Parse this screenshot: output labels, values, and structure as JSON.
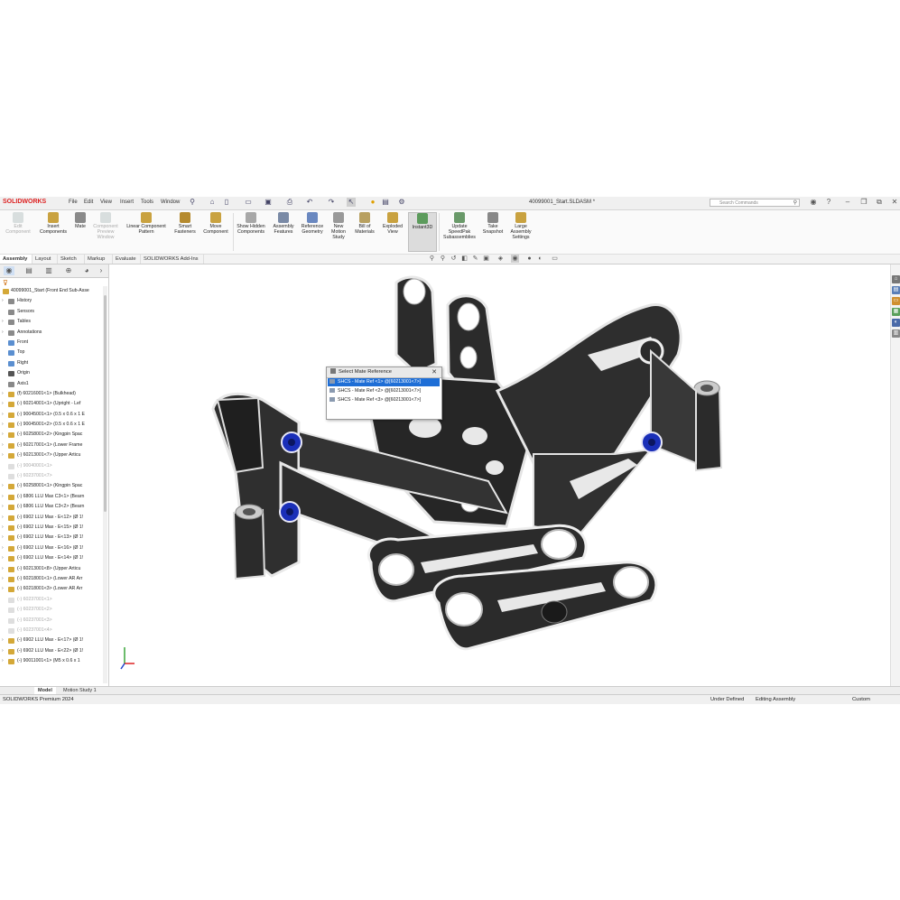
{
  "app": {
    "logo": "SOLIDWORKS",
    "menus": [
      "File",
      "Edit",
      "View",
      "Insert",
      "Tools",
      "Window"
    ],
    "document_title": "40099001_Start.SLDASM *",
    "search_placeholder": "Search Commands"
  },
  "commands": [
    {
      "label": "Edit Component",
      "enabled": false
    },
    {
      "label": "Insert Components",
      "enabled": true
    },
    {
      "label": "Mate",
      "enabled": true
    },
    {
      "label": "Component Preview Window",
      "enabled": false
    },
    {
      "label": "Linear Component Pattern",
      "enabled": true
    },
    {
      "label": "Smart Fasteners",
      "enabled": true
    },
    {
      "label": "Move Component",
      "enabled": true
    },
    {
      "label": "Show Hidden Components",
      "enabled": true
    },
    {
      "label": "Assembly Features",
      "enabled": true
    },
    {
      "label": "Reference Geometry",
      "enabled": true
    },
    {
      "label": "New Motion Study",
      "enabled": true
    },
    {
      "label": "Bill of Materials",
      "enabled": true
    },
    {
      "label": "Exploded View",
      "enabled": true
    },
    {
      "label": "Instant3D",
      "enabled": true,
      "active": true
    },
    {
      "label": "Update SpeedPak Subassemblies",
      "enabled": true
    },
    {
      "label": "Take Snapshot",
      "enabled": true
    },
    {
      "label": "Large Assembly Settings",
      "enabled": true
    }
  ],
  "tabs": [
    "Assembly",
    "Layout",
    "Sketch",
    "Markup",
    "Evaluate",
    "SOLIDWORKS Add-Ins"
  ],
  "tree": {
    "root": "40099001_Start (Front End Sub-Asse",
    "items": [
      {
        "label": "History",
        "icon": "history-icon",
        "expand": true,
        "suppressed": false
      },
      {
        "label": "Sensors",
        "icon": "sensor-icon",
        "expand": false,
        "suppressed": false
      },
      {
        "label": "Tables",
        "icon": "table-icon",
        "expand": true,
        "suppressed": false
      },
      {
        "label": "Annotations",
        "icon": "annotation-icon",
        "expand": true,
        "suppressed": false
      },
      {
        "label": "Front",
        "icon": "plane-icon",
        "expand": false,
        "suppressed": false
      },
      {
        "label": "Top",
        "icon": "plane-icon",
        "expand": false,
        "suppressed": false
      },
      {
        "label": "Right",
        "icon": "plane-icon",
        "expand": false,
        "suppressed": false
      },
      {
        "label": "Origin",
        "icon": "origin-icon",
        "expand": false,
        "suppressed": false
      },
      {
        "label": "Axis1",
        "icon": "axis-icon",
        "expand": false,
        "suppressed": false
      },
      {
        "label": "(f) 60216001<1> (Bulkhead)",
        "icon": "part-icon",
        "expand": true,
        "suppressed": false
      },
      {
        "label": "(-) 60214001<1> (Upright - Lef",
        "icon": "part-icon",
        "expand": true,
        "suppressed": false
      },
      {
        "label": "(-) 90045001<1> (0.5 x 0.6 x 1 E",
        "icon": "part-icon",
        "expand": true,
        "suppressed": false
      },
      {
        "label": "(-) 90045001<2> (0.5 x 0.6 x 1 E",
        "icon": "part-icon",
        "expand": true,
        "suppressed": false
      },
      {
        "label": "(-) 60258001<2> (Kingpin Spac",
        "icon": "part-icon",
        "expand": true,
        "suppressed": false
      },
      {
        "label": "(-) 60217001<1> (Lower Frame",
        "icon": "part-icon",
        "expand": true,
        "suppressed": false
      },
      {
        "label": "(-) 60213001<7> (Upper Articu",
        "icon": "part-icon",
        "expand": true,
        "suppressed": false
      },
      {
        "label": "(-) 90040001<1>",
        "icon": "part-icon",
        "expand": false,
        "suppressed": true
      },
      {
        "label": "(-) 60237001<7>",
        "icon": "part-icon",
        "expand": false,
        "suppressed": true
      },
      {
        "label": "(-) 60258001<1> (Kingpin Spac",
        "icon": "part-icon",
        "expand": true,
        "suppressed": false
      },
      {
        "label": "(-) 6806 LLU Max C3<1> (Bearn",
        "icon": "part-icon",
        "expand": true,
        "suppressed": false
      },
      {
        "label": "(-) 6806 LLU Max C3<2> (Bearn",
        "icon": "part-icon",
        "expand": true,
        "suppressed": false
      },
      {
        "label": "(-) 6902 LLU Max - E<12> (Ø 1!",
        "icon": "part-icon",
        "expand": true,
        "suppressed": false
      },
      {
        "label": "(-) 6902 LLU Max - E<15> (Ø 1!",
        "icon": "part-icon",
        "expand": true,
        "suppressed": false
      },
      {
        "label": "(-) 6902 LLU Max - E<13> (Ø 1!",
        "icon": "part-icon",
        "expand": true,
        "suppressed": false
      },
      {
        "label": "(-) 6902 LLU Max - E<16> (Ø 1!",
        "icon": "part-icon",
        "expand": true,
        "suppressed": false
      },
      {
        "label": "(-) 6902 LLU Max - E<14> (Ø 1!",
        "icon": "part-icon",
        "expand": true,
        "suppressed": false
      },
      {
        "label": "(-) 60213001<8> (Upper Articu",
        "icon": "part-icon",
        "expand": true,
        "suppressed": false
      },
      {
        "label": "(-) 60218001<1> (Lower AR Arr",
        "icon": "part-icon",
        "expand": true,
        "suppressed": false
      },
      {
        "label": "(-) 60218001<3> (Lower AR Arr",
        "icon": "part-icon",
        "expand": true,
        "suppressed": false
      },
      {
        "label": "(-) 60237001<1>",
        "icon": "part-icon",
        "expand": false,
        "suppressed": true
      },
      {
        "label": "(-) 60237001<2>",
        "icon": "part-icon",
        "expand": false,
        "suppressed": true
      },
      {
        "label": "(-) 60237001<3>",
        "icon": "part-icon",
        "expand": false,
        "suppressed": true
      },
      {
        "label": "(-) 60237001<4>",
        "icon": "part-icon",
        "expand": false,
        "suppressed": true
      },
      {
        "label": "(-) 6902 LLU Max - E<17> (Ø 1!",
        "icon": "part-icon",
        "expand": true,
        "suppressed": false
      },
      {
        "label": "(-) 6902 LLU Max - E<22> (Ø 1!",
        "icon": "part-icon",
        "expand": true,
        "suppressed": false
      },
      {
        "label": "(-) 90011001<1> (M5 x 0.6 x 1",
        "icon": "part-icon",
        "expand": true,
        "suppressed": false
      }
    ]
  },
  "popup": {
    "title": "Select Mate Reference",
    "close": "✕",
    "rows": [
      {
        "label": "SHCS - Mate Ref <1> @[60213001<7>]",
        "selected": true
      },
      {
        "label": "SHCS - Mate Ref <2> @[60213001<7>]",
        "selected": false
      },
      {
        "label": "SHCS - Mate Ref <3> @[60213001<7>]",
        "selected": false
      }
    ]
  },
  "bottom_tabs": [
    "Model",
    "Motion Study 1"
  ],
  "status": {
    "product": "SOLIDWORKS Premium 2024",
    "state": "Under Defined",
    "mode": "Editing Assembly",
    "units": "Custom"
  },
  "colors": {
    "accent": "#1e6ed6",
    "part_dark": "#2b2b2b",
    "bolt_blue": "#1a2fb8",
    "brand_red": "#d22222"
  }
}
